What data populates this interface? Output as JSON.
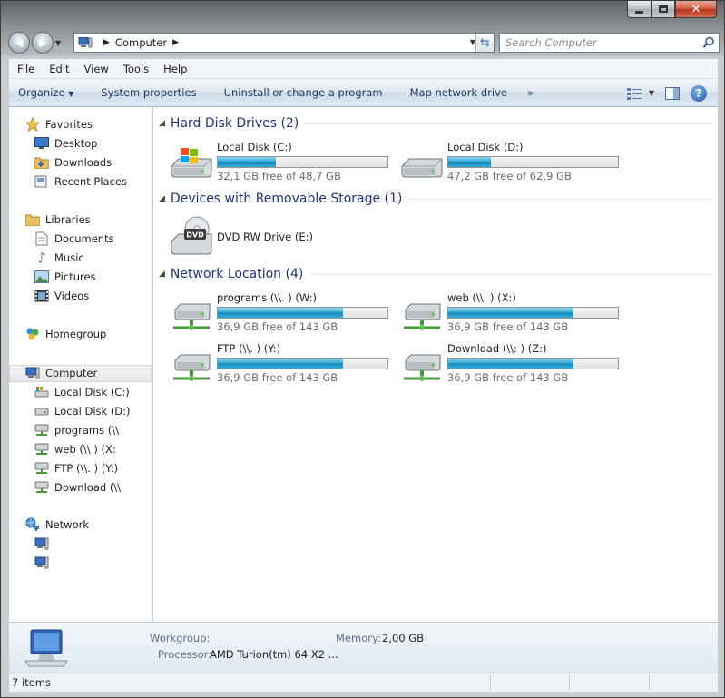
{
  "address": {
    "segment": "Computer"
  },
  "search": {
    "placeholder": "Search Computer"
  },
  "menu": [
    "File",
    "Edit",
    "View",
    "Tools",
    "Help"
  ],
  "toolbar": {
    "organize": "Organize",
    "system_properties": "System properties",
    "uninstall": "Uninstall or change a program",
    "map_drive": "Map network drive",
    "more": "»"
  },
  "sidebar": {
    "favorites": {
      "label": "Favorites",
      "items": [
        "Desktop",
        "Downloads",
        "Recent Places"
      ]
    },
    "libraries": {
      "label": "Libraries",
      "items": [
        "Documents",
        "Music",
        "Pictures",
        "Videos"
      ]
    },
    "homegroup": "Homegroup",
    "computer": {
      "label": "Computer",
      "items": [
        "Local Disk (C:)",
        "Local Disk (D:)",
        "programs (\\\\",
        "web (\\\\            ) (X:",
        "FTP (\\\\.            ) (Y:)",
        "Download (\\\\"
      ]
    },
    "network": {
      "label": "Network",
      "items": [
        "",
        ""
      ]
    }
  },
  "groups": {
    "hdd": "Hard Disk Drives (2)",
    "removable": "Devices with Removable Storage (1)",
    "network": "Network Location (4)"
  },
  "drives": [
    {
      "name": "Local Disk (C:)",
      "free": "32,1 GB free of 48,7 GB",
      "used_fraction": 0.34
    },
    {
      "name": "Local Disk (D:)",
      "free": "47,2 GB free of 62,9 GB",
      "used_fraction": 0.25
    }
  ],
  "removable": [
    {
      "name": "DVD RW Drive (E:)",
      "icon_text": "DVD"
    }
  ],
  "network_locations": [
    {
      "name": "programs (\\\\.            ) (W:)",
      "free": "36,9 GB free of 143 GB",
      "used_fraction": 0.74
    },
    {
      "name": "web (\\\\.            ) (X:)",
      "free": "36,9 GB free of 143 GB",
      "used_fraction": 0.74
    },
    {
      "name": "FTP (\\\\.            ) (Y:)",
      "free": "36,9 GB free of 143 GB",
      "used_fraction": 0.74
    },
    {
      "name": "Download (\\\\:            ) (Z:)",
      "free": "36,9 GB free of 143 GB",
      "used_fraction": 0.74
    }
  ],
  "details": {
    "workgroup_label": "Workgroup:",
    "memory_label": "Memory:",
    "memory_value": "2,00 GB",
    "processor_label": "Processor:",
    "processor_value": "AMD Turion(tm) 64 X2 ..."
  },
  "status": {
    "items": "7 items"
  },
  "colors": {
    "accent": "#1e3287",
    "bar_fill": "#2aa4d2"
  }
}
